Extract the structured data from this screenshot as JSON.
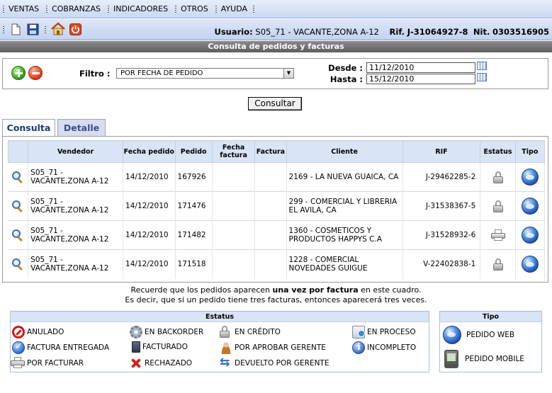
{
  "menu": [
    "VENTAS",
    "COBRANZAS",
    "INDICADORES",
    "OTROS",
    "AYUDA"
  ],
  "user": {
    "usuario_label": "Usuario:",
    "usuario_value": "S05_71 - VACANTE,ZONA A-12",
    "rif_label": "Rif.",
    "rif_value": "J-31064927-8",
    "nit_label": "Nit.",
    "nit_value": "0303516905"
  },
  "title": "Consulta de pedidos y facturas",
  "filter": {
    "label": "Filtro :",
    "selected": "POR FECHA DE PEDIDO",
    "desde_label": "Desde :",
    "desde_value": "11/12/2010",
    "hasta_label": "Hasta :",
    "hasta_value": "15/12/2010"
  },
  "consult_button": "Consultar",
  "tabs": [
    "Consulta",
    "Detalle"
  ],
  "table": {
    "headers": [
      "Vendedor",
      "Fecha pedido",
      "Pedido",
      "Fecha factura",
      "Factura",
      "Cliente",
      "RIF",
      "Estatus",
      "Tipo"
    ],
    "rows": [
      {
        "vendedor": "S05_71 - VACANTE,ZONA A-12",
        "fecha_pedido": "14/12/2010",
        "pedido": "167926",
        "fecha_factura": "",
        "factura": "",
        "cliente": "2169 - LA NUEVA GUAICA, CA",
        "rif": "J-29462285-2",
        "estatus": "lock-icon",
        "tipo": "globe-icon"
      },
      {
        "vendedor": "S05_71 - VACANTE,ZONA A-12",
        "fecha_pedido": "14/12/2010",
        "pedido": "171476",
        "fecha_factura": "",
        "factura": "",
        "cliente": "299 - COMERCIAL Y LIBRERIA EL AVILA, CA",
        "rif": "J-31538367-5",
        "estatus": "lock-icon",
        "tipo": "globe-icon"
      },
      {
        "vendedor": "S05_71 - VACANTE,ZONA A-12",
        "fecha_pedido": "14/12/2010",
        "pedido": "171482",
        "fecha_factura": "",
        "factura": "",
        "cliente": "1360 - COSMETICOS Y PRODUCTOS HAPPYS C.A",
        "rif": "J-31528932-6",
        "estatus": "printer-icon",
        "tipo": "globe-icon"
      },
      {
        "vendedor": "S05_71 - VACANTE,ZONA A-12",
        "fecha_pedido": "14/12/2010",
        "pedido": "171518",
        "fecha_factura": "",
        "factura": "",
        "cliente": "1228 - COMERCIAL NOVEDADES GUIGUE",
        "rif": "V-22402838-1",
        "estatus": "lock-icon",
        "tipo": "globe-icon"
      }
    ]
  },
  "notice": {
    "line1_a": "Recuerde que los pedidos aparecen ",
    "line1_b": "una vez por factura",
    "line1_c": " en este cuadro.",
    "line2": "Es decir, que si un pedido tiene tres facturas, entonces aparecerá tres veces."
  },
  "legend_estatus": {
    "title": "Estatus",
    "items": [
      "ANULADO",
      "EN BACKORDER",
      "EN CRÉDITO",
      "EN PROCESO",
      "FACTURA ENTREGADA",
      "FACTURADO",
      "POR APROBAR GERENTE",
      "INCOMPLETO",
      "POR FACTURAR",
      "RECHAZADO",
      "DEVUELTO POR GERENTE"
    ]
  },
  "legend_tipo": {
    "title": "Tipo",
    "items": [
      "PEDIDO WEB",
      "PEDIDO MOBILE"
    ]
  }
}
